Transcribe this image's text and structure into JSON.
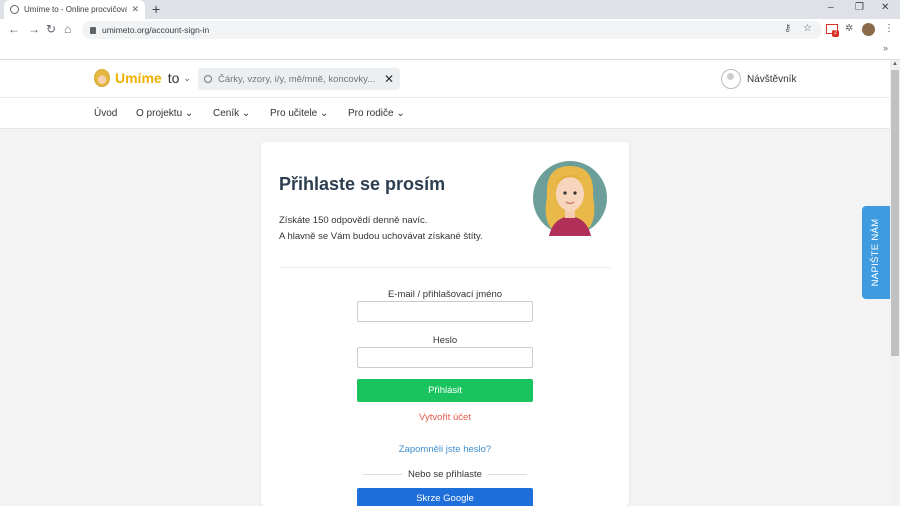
{
  "browser": {
    "tab_title": "Umíme to - Online procvičování",
    "tab_close": "✕",
    "new_tab": "+",
    "url": "umimeto.org/account-sign-in",
    "window_controls": [
      "–",
      "❐",
      "✕"
    ],
    "bookmarks_more": "»",
    "extension_badge": "2"
  },
  "site": {
    "logo_brand": "Umíme",
    "logo_suffix": "to",
    "search_placeholder": "Čárky, vzory, i/y, mě/mně, koncovky...",
    "user_label": "Návštěvník",
    "nav": [
      "Úvod",
      "O projektu",
      "Ceník",
      "Pro učitele",
      "Pro rodiče"
    ]
  },
  "login": {
    "title": "Přihlaste se prosím",
    "subtitle_line1": "Získáte 150 odpovědí denně navíc.",
    "subtitle_line2": "A hlavně se Vám budou uchovávat získané štíty.",
    "email_label": "E-mail / přihlašovací jméno",
    "password_label": "Heslo",
    "login_button": "Přihlásit",
    "create_account": "Vytvořit účet",
    "forgot_password": "Zapomněli jste heslo?",
    "or_login": "Nebo se přihlaste",
    "google_button": "Skrze Google"
  },
  "feedback": {
    "label": "NAPIŠTE NÁM"
  },
  "colors": {
    "accent_green": "#19c45f",
    "link_red": "#e4574a",
    "link_blue": "#3f8fd2",
    "google_blue": "#1e6fd9",
    "feedback_blue": "#3e9be0",
    "brand_yellow": "#f0b000"
  }
}
